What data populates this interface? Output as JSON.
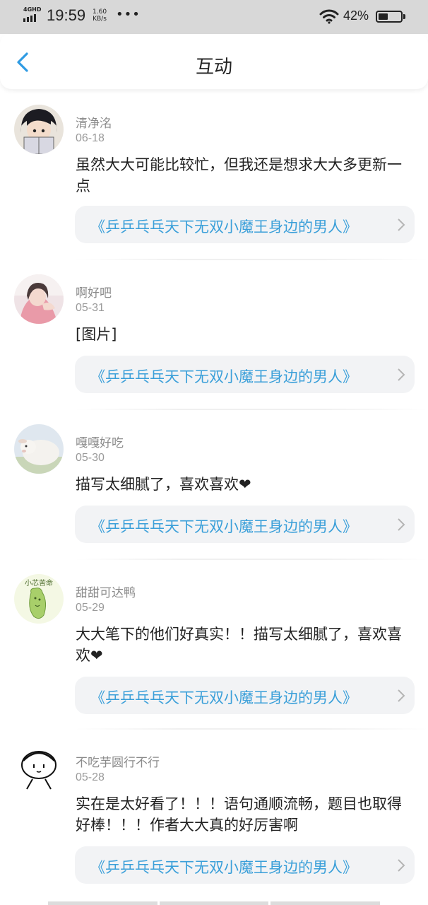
{
  "status_bar": {
    "network": "4GHD",
    "time": "19:59",
    "speed_value": "1.60",
    "speed_unit": "KB/s",
    "more": "•••",
    "battery_text": "42%",
    "battery_level": 0.42
  },
  "header": {
    "title": "互动",
    "back_icon": "chevron-left-icon"
  },
  "accent_color": "#3a9fd9",
  "comments": [
    {
      "username": "清净洺",
      "date": "06-18",
      "content": "虽然大大可能比较忙，但我还是想求大大多更新一点",
      "book": "《乒乒乓乓天下无双小魔王身边的男人》"
    },
    {
      "username": "啊好吧",
      "date": "05-31",
      "content": "[图片]",
      "book": "《乒乒乓乓天下无双小魔王身边的男人》"
    },
    {
      "username": "嘎嘎好吃",
      "date": "05-30",
      "content": "描写太细腻了，喜欢喜欢❤",
      "book": "《乒乒乓乓天下无双小魔王身边的男人》"
    },
    {
      "username": "甜甜可达鸭",
      "date": "05-29",
      "content": "大大笔下的他们好真实！！描写太细腻了，喜欢喜欢❤",
      "book": "《乒乒乓乓天下无双小魔王身边的男人》",
      "avatar_text": "小芯苦命"
    },
    {
      "username": "不吃芋圆行不行",
      "date": "05-28",
      "content": "实在是太好看了！！！语句通顺流畅，题目也取得好棒！！！作者大大真的好厉害啊",
      "book": "《乒乒乓乓天下无双小魔王身边的男人》"
    }
  ]
}
